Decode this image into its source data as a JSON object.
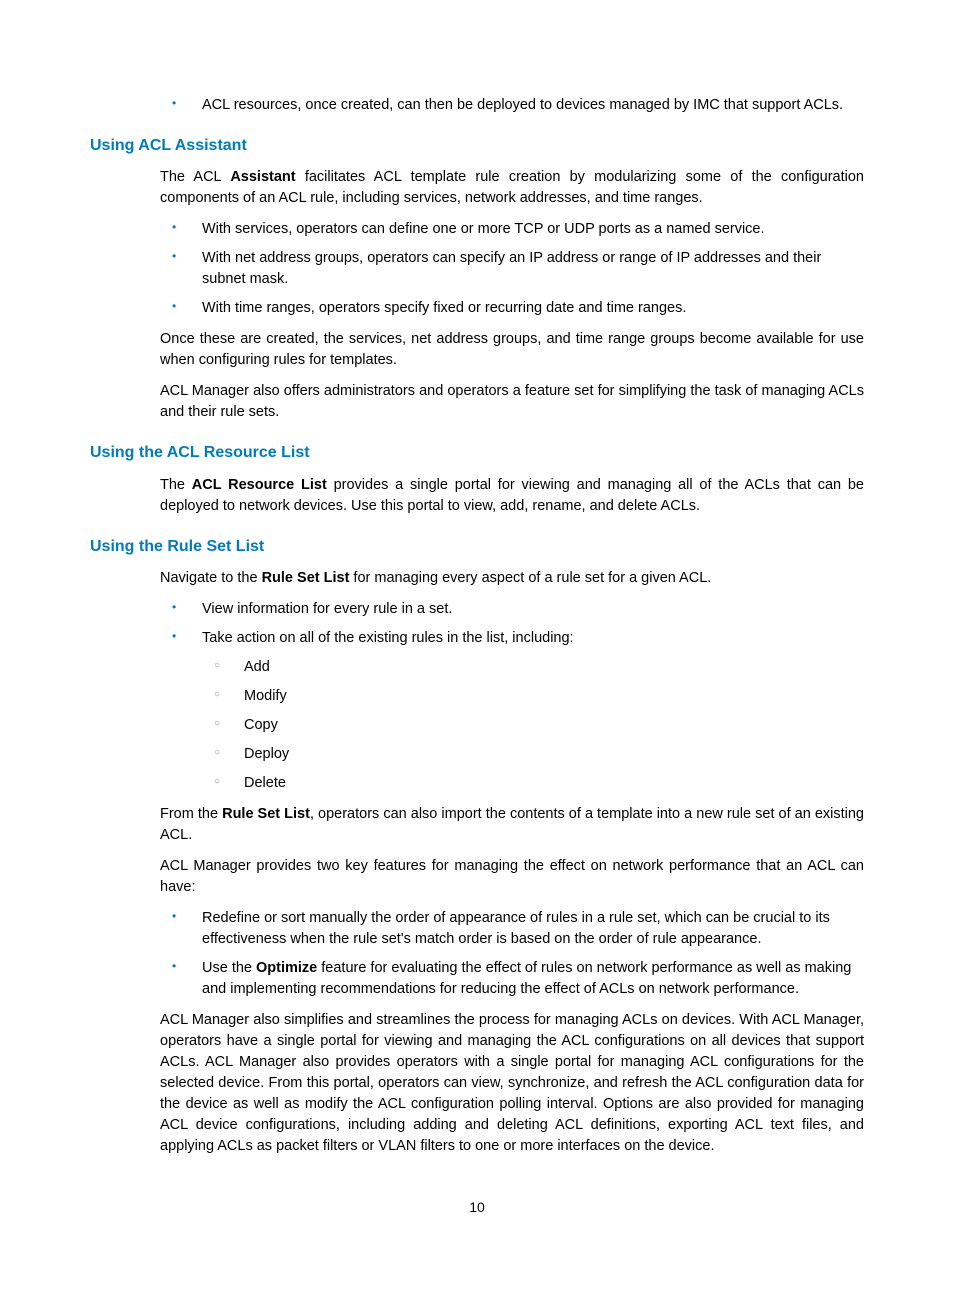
{
  "intro_bullet": "ACL resources, once created, can then be deployed to devices managed by IMC that support ACLs.",
  "s1": {
    "heading": "Using ACL Assistant",
    "p1_a": "The ACL ",
    "p1_b": "Assistant",
    "p1_c": " facilitates ACL template rule creation by modularizing some of the configuration components of an ACL rule, including services, network addresses, and time ranges.",
    "b1": "With services, operators can define one or more TCP or UDP ports as a named service.",
    "b2": "With net address groups, operators can specify an IP address or range of IP addresses and their subnet mask.",
    "b3": "With time ranges, operators specify fixed or recurring date and time ranges.",
    "p2": "Once these are created, the services, net address groups, and time range groups become available for use when configuring rules for templates.",
    "p3": "ACL Manager also offers administrators and operators a feature set for simplifying the task of managing ACLs and their rule sets."
  },
  "s2": {
    "heading": "Using the ACL Resource List",
    "p1_a": "The ",
    "p1_b": "ACL Resource List",
    "p1_c": " provides a single portal for viewing and managing all of the ACLs that can be deployed to network devices. Use this portal to view, add, rename, and delete ACLs."
  },
  "s3": {
    "heading": "Using the Rule Set List",
    "p1_a": "Navigate to the ",
    "p1_b": "Rule Set List",
    "p1_c": " for managing every aspect of a rule set for a given ACL.",
    "b1": "View information for every rule in a set.",
    "b2": "Take action on all of the existing rules in the list, including:",
    "sub1": "Add",
    "sub2": "Modify",
    "sub3": "Copy",
    "sub4": "Deploy",
    "sub5": "Delete",
    "p2_a": "From the ",
    "p2_b": "Rule Set List",
    "p2_c": ", operators can also import the contents of a template into a new rule set of an existing ACL.",
    "p3": "ACL Manager provides two key features for managing the effect on network performance that an ACL can have:",
    "b3": "Redefine or sort manually the order of appearance of rules in a rule set, which can be crucial to its effectiveness when the rule set's match order is based on the order of rule appearance.",
    "b4_a": "Use the ",
    "b4_b": "Optimize",
    "b4_c": " feature for evaluating the effect of rules on network performance as well as making and implementing recommendations for reducing the effect of ACLs on network performance.",
    "p4": "ACL Manager also simplifies and streamlines the process for managing ACLs on devices. With ACL Manager, operators have a single portal for viewing and managing the ACL configurations on all devices that support ACLs. ACL Manager also provides operators with a single portal for managing ACL configurations for the selected device. From this portal, operators can view, synchronize, and refresh the ACL configuration data for the device as well as modify the ACL configuration polling interval. Options are also provided for managing ACL device configurations, including adding and deleting ACL definitions, exporting ACL text files, and applying ACLs as packet filters or VLAN filters to one or more interfaces on the device."
  },
  "pagenum": "10"
}
